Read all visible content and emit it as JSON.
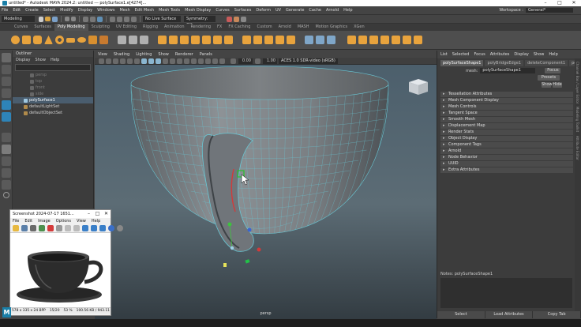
{
  "window": {
    "title": "untitled* - Autodesk MAYA 2024.2: untitled   ---   polySurface1.e[4274]..."
  },
  "menubar": [
    "File",
    "Edit",
    "Create",
    "Select",
    "Modify",
    "Display",
    "Windows",
    "Mesh",
    "Edit Mesh",
    "Mesh Tools",
    "Mesh Display",
    "Curves",
    "Surfaces",
    "Deform",
    "UV",
    "Generate",
    "Cache",
    "Arnold",
    "Help"
  ],
  "workspace": {
    "label": "Workspace :",
    "value": "General*"
  },
  "statusline": {
    "mode": "Modeling",
    "live_surface": "No Live Surface",
    "symmetry": "Symmetry: Off"
  },
  "shelf_tabs": [
    "Curves",
    "Surfaces",
    "Poly Modeling",
    "Sculpting",
    "UV Editing",
    "Rigging",
    "Animation",
    "Rendering",
    "FX",
    "FX Caching",
    "Custom",
    "Arnold",
    "MASH",
    "Motion Graphics",
    "XGen"
  ],
  "shelf_active": "Poly Modeling",
  "outliner": {
    "title": "Outliner",
    "menu": [
      "Display",
      "Show",
      "Help"
    ],
    "items": [
      {
        "label": "persp",
        "state": "dim"
      },
      {
        "label": "top",
        "state": "dim"
      },
      {
        "label": "front",
        "state": "dim"
      },
      {
        "label": "side",
        "state": "dim"
      },
      {
        "label": "polySurface1",
        "state": "selected"
      },
      {
        "label": "defaultLightSet",
        "state": "normal"
      },
      {
        "label": "defaultObjectSet",
        "state": "normal"
      }
    ]
  },
  "viewport": {
    "menu": [
      "View",
      "Shading",
      "Lighting",
      "Show",
      "Renderer",
      "Panels"
    ],
    "near_value": "0.00",
    "far_value": "1.00",
    "color_space": "ACES 1.0 SDR-video (sRGB)",
    "camera": "persp"
  },
  "attribute_editor": {
    "menu": [
      "List",
      "Selected",
      "Focus",
      "Attributes",
      "Display",
      "Show",
      "Help"
    ],
    "tabs": [
      "polySurfaceShape1",
      "polyBridgeEdge1",
      "deleteComponent1",
      "polySewE..."
    ],
    "node_label": "mesh:",
    "node_value": "polySurfaceShape1",
    "focus_label": "Focus",
    "presets_label": "Presets",
    "show_label": "Show",
    "hide_label": "Hide",
    "sections": [
      "Tessellation Attributes",
      "Mesh Component Display",
      "Mesh Controls",
      "Tangent Space",
      "Smooth Mesh",
      "Displacement Map",
      "Render Stats",
      "Object Display",
      "Component Tags",
      "Arnold",
      "Node Behavior",
      "UUID",
      "Extra Attributes"
    ],
    "notes_label": "Notes: polySurfaceShape1",
    "bottom": [
      "Select",
      "Load Attributes",
      "Copy Tab"
    ],
    "side_tabs": [
      "Channel Box / Layer Editor",
      "Modeling Toolkit",
      "Attribute Editor"
    ]
  },
  "viewer": {
    "title": "Screenshot 2024-07-17 1651...",
    "menu": [
      "File",
      "Edit",
      "Image",
      "Options",
      "View",
      "Help"
    ],
    "status": [
      "578 x 335 x 24 BPP",
      "15/20",
      "53 %",
      "100.56 KB / 943.11 K"
    ]
  },
  "colors": {
    "accent": "#e8a33d",
    "selection": "#4a5d6e",
    "wire": "#69c7d4",
    "maya_blue": "#1a7fa8"
  }
}
